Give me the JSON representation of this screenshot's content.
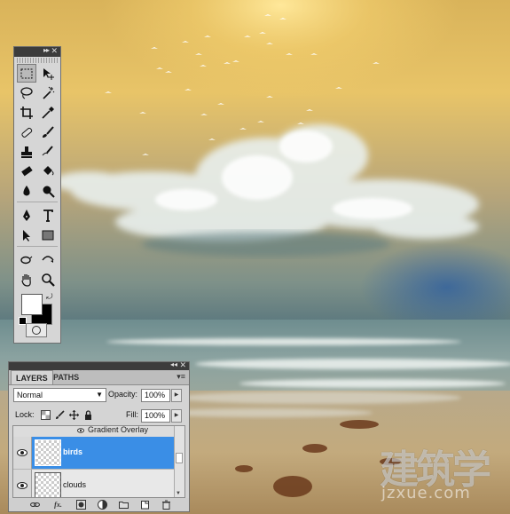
{
  "toolbox": {
    "tools": [
      {
        "name": "rectangular-marquee-tool",
        "active": true
      },
      {
        "name": "move-tool"
      },
      {
        "name": "lasso-tool"
      },
      {
        "name": "magic-wand-tool"
      },
      {
        "name": "crop-tool"
      },
      {
        "name": "eyedropper-tool"
      },
      {
        "name": "healing-brush-tool"
      },
      {
        "name": "brush-tool"
      },
      {
        "name": "clone-stamp-tool"
      },
      {
        "name": "history-brush-tool"
      },
      {
        "name": "eraser-tool"
      },
      {
        "name": "paint-bucket-tool"
      },
      {
        "name": "blur-tool"
      },
      {
        "name": "dodge-tool"
      },
      {
        "name": "pen-tool"
      },
      {
        "name": "type-tool"
      },
      {
        "name": "path-selection-tool"
      },
      {
        "name": "rectangle-tool"
      },
      {
        "name": "3d-rotate-tool"
      },
      {
        "name": "3d-orbit-tool"
      },
      {
        "name": "hand-tool"
      },
      {
        "name": "zoom-tool"
      }
    ],
    "foreground_color": "#ffffff",
    "background_color": "#000000"
  },
  "layers_panel": {
    "tabs": [
      "LAYERS",
      "PATHS"
    ],
    "blend_mode": "Normal",
    "opacity_label": "Opacity:",
    "opacity_value": "100%",
    "lock_label": "Lock:",
    "fill_label": "Fill:",
    "fill_value": "100%",
    "effect_label": "Gradient Overlay",
    "layers": [
      {
        "name": "birds",
        "selected": true,
        "visible": true
      },
      {
        "name": "clouds",
        "selected": false,
        "visible": true
      }
    ],
    "selection_color": "#3a8ee6"
  },
  "watermark": {
    "chinese": "建筑学",
    "url": "jzxue.com"
  }
}
